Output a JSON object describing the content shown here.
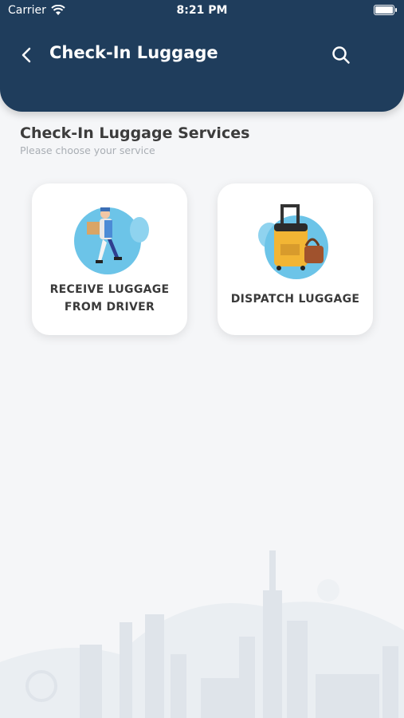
{
  "status_bar": {
    "carrier": "Carrier",
    "time": "8:21 PM"
  },
  "header": {
    "title": "Check-In Luggage",
    "back_icon": "chevron-left-icon",
    "search_icon": "search-icon",
    "background_color": "#1f3d5c"
  },
  "section": {
    "title": "Check-In Luggage Services",
    "subtitle": "Please choose your service"
  },
  "services": [
    {
      "label_line1": "RECEIVE LUGGAGE",
      "label_line2": "FROM DRIVER",
      "icon": "delivery-person-icon"
    },
    {
      "label_line1": "DISPATCH LUGGAGE",
      "label_line2": "",
      "icon": "suitcase-icon"
    }
  ],
  "colors": {
    "accent_blue": "#6cc4e8",
    "suitcase": "#f2b534",
    "bag": "#a0522d",
    "background": "#f5f6f8"
  }
}
